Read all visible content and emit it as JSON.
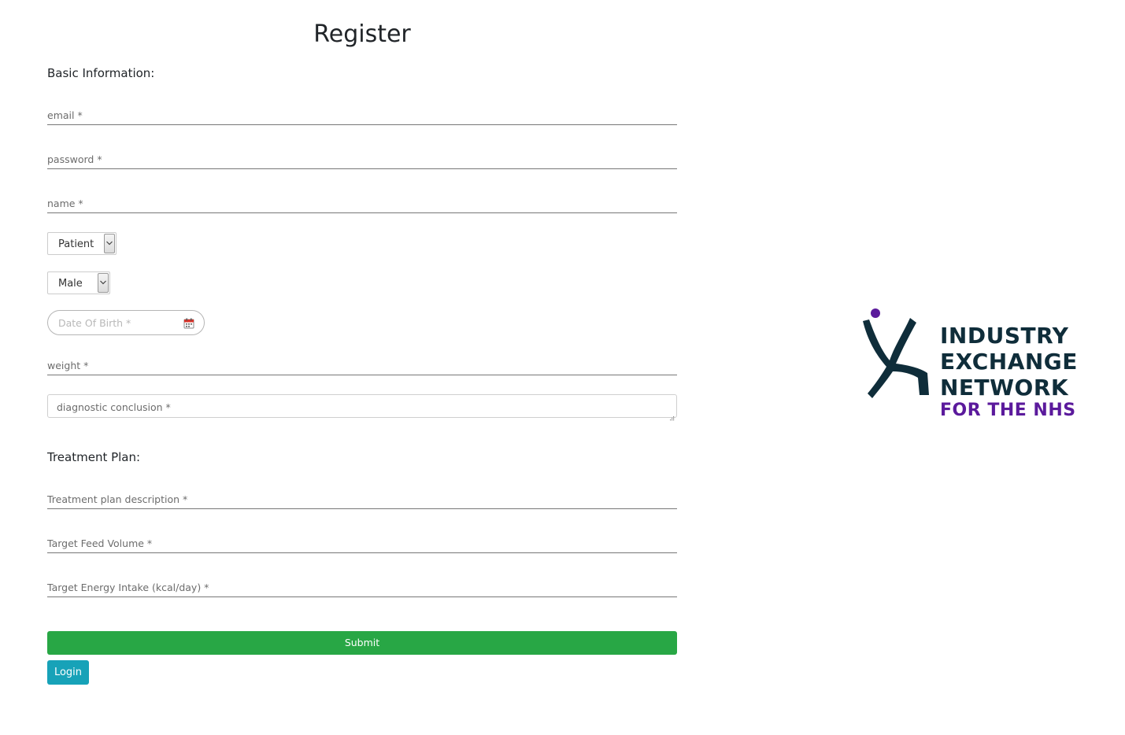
{
  "form": {
    "title": "Register",
    "basic_heading": "Basic Information:",
    "email_label": "email *",
    "password_label": "password *",
    "name_label": "name *",
    "role_select_value": "Patient",
    "gender_select_value": "Male",
    "dob_placeholder": "Date Of Birth *",
    "weight_label": "weight *",
    "diagnostic_placeholder": "diagnostic conclusion *",
    "treatment_heading": "Treatment Plan:",
    "treatment_description_label": "Treatment plan description *",
    "target_feed_label": "Target Feed Volume *",
    "target_energy_label": "Target Energy Intake (kcal/day) *",
    "submit_label": "Submit",
    "login_label": "Login"
  },
  "logo": {
    "line1": "INDUSTRY",
    "line2": "EXCHANGE",
    "line3": "NETWORK",
    "line4": "FOR THE NHS"
  },
  "colors": {
    "submit_bg": "#28a745",
    "login_bg": "#17a2b8",
    "logo_dark": "#0f2d3a",
    "logo_purple": "#5b1a9c"
  },
  "icons": {
    "select_arrow": "chevron-down-icon",
    "calendar": "calendar-icon",
    "resize_grip": "resize-grip-icon"
  }
}
